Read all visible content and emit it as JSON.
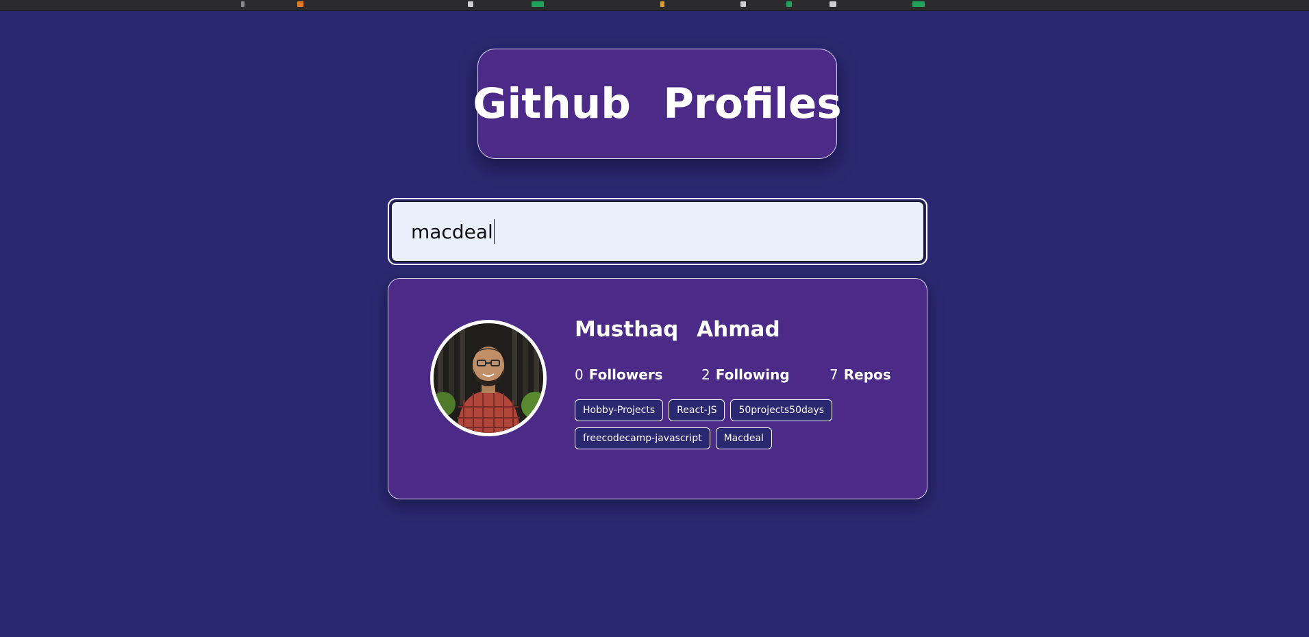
{
  "app": {
    "title": "Github Profiles"
  },
  "search": {
    "value": "macdeal"
  },
  "profile": {
    "name": "Musthaq Ahmad",
    "stats": [
      {
        "value": "0",
        "label": "Followers"
      },
      {
        "value": "2",
        "label": "Following"
      },
      {
        "value": "7",
        "label": "Repos"
      }
    ],
    "repos": [
      "Hobby-Projects",
      "React-JS",
      "50projects50days",
      "freecodecamp-javascript",
      "Macdeal"
    ]
  },
  "colors": {
    "background": "#2a2870",
    "card": "#4c2a87",
    "input_background": "#e9effb",
    "repo_chip": "#2a2870",
    "text": "#ffffff"
  },
  "icons": {
    "avatar": "user-photo"
  }
}
